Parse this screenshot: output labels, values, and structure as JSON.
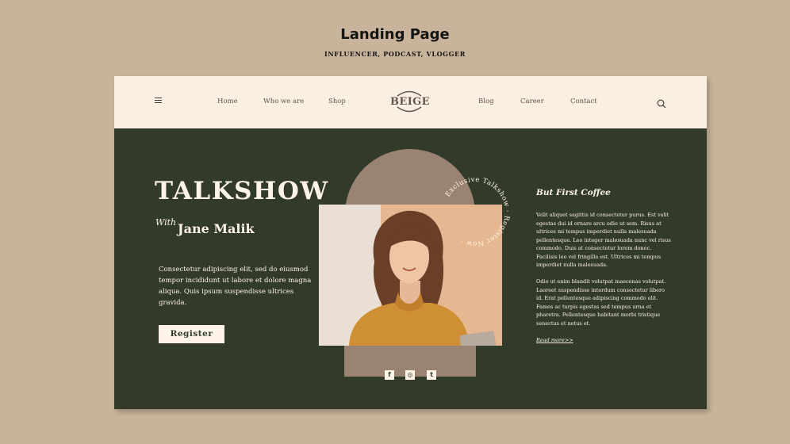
{
  "page": {
    "heading": "Landing Page",
    "subheading": "INFLUENCER, PODCAST, VLOGGER"
  },
  "nav": {
    "left_links": [
      "Home",
      "Who we are",
      "Shop"
    ],
    "logo": "BEIGE",
    "right_links": [
      "Blog",
      "Career",
      "Contact"
    ],
    "menu_icon": "hamburger-icon",
    "search_icon": "search-icon"
  },
  "hero": {
    "title": "TALKSHOW",
    "with_label": "With",
    "name": "Jane Malik",
    "description": "Consectetur adipiscing elit, sed do eiusmod tempor incididunt ut labore et dolore magna aliqua. Quis ipsum suspendisse ultrices gravida.",
    "register_label": "Register",
    "badge_text": "Exclusive Talkshow · Register Now ·",
    "social": [
      "f",
      "◎",
      "t"
    ]
  },
  "side": {
    "title": "But First Coffee",
    "paragraph1": "Velit aliquet sagittis id consectetur purus. Est velit egestas dui id ornare arcu odio ut sem. Risus at ultrices mi tempus imperdiet nulla malesuada pellentesque. Leo integer malesuada nunc vel risus commodo. Duis at consectetur lorem donec. Facilisis leo vel fringilla est. Ultrices mi tempus imperdiet nulla malesuada.",
    "paragraph2": "Odio ut enim blandit volutpat maecenas volutpat. Laoreet suspendisse interdum consectetur libero id. Erat pellentesque adipiscing commodo elit. Fames ac turpis egestas sed tempus urna et pharetra. Pellentesque habitant morbi tristique senectus et netus et.",
    "read_more": "Read more>>"
  },
  "colors": {
    "background": "#c8b49a",
    "navbar": "#fcefe2",
    "hero": "#323a2a",
    "accent": "#9a8372",
    "cream": "#fdf3e6"
  }
}
